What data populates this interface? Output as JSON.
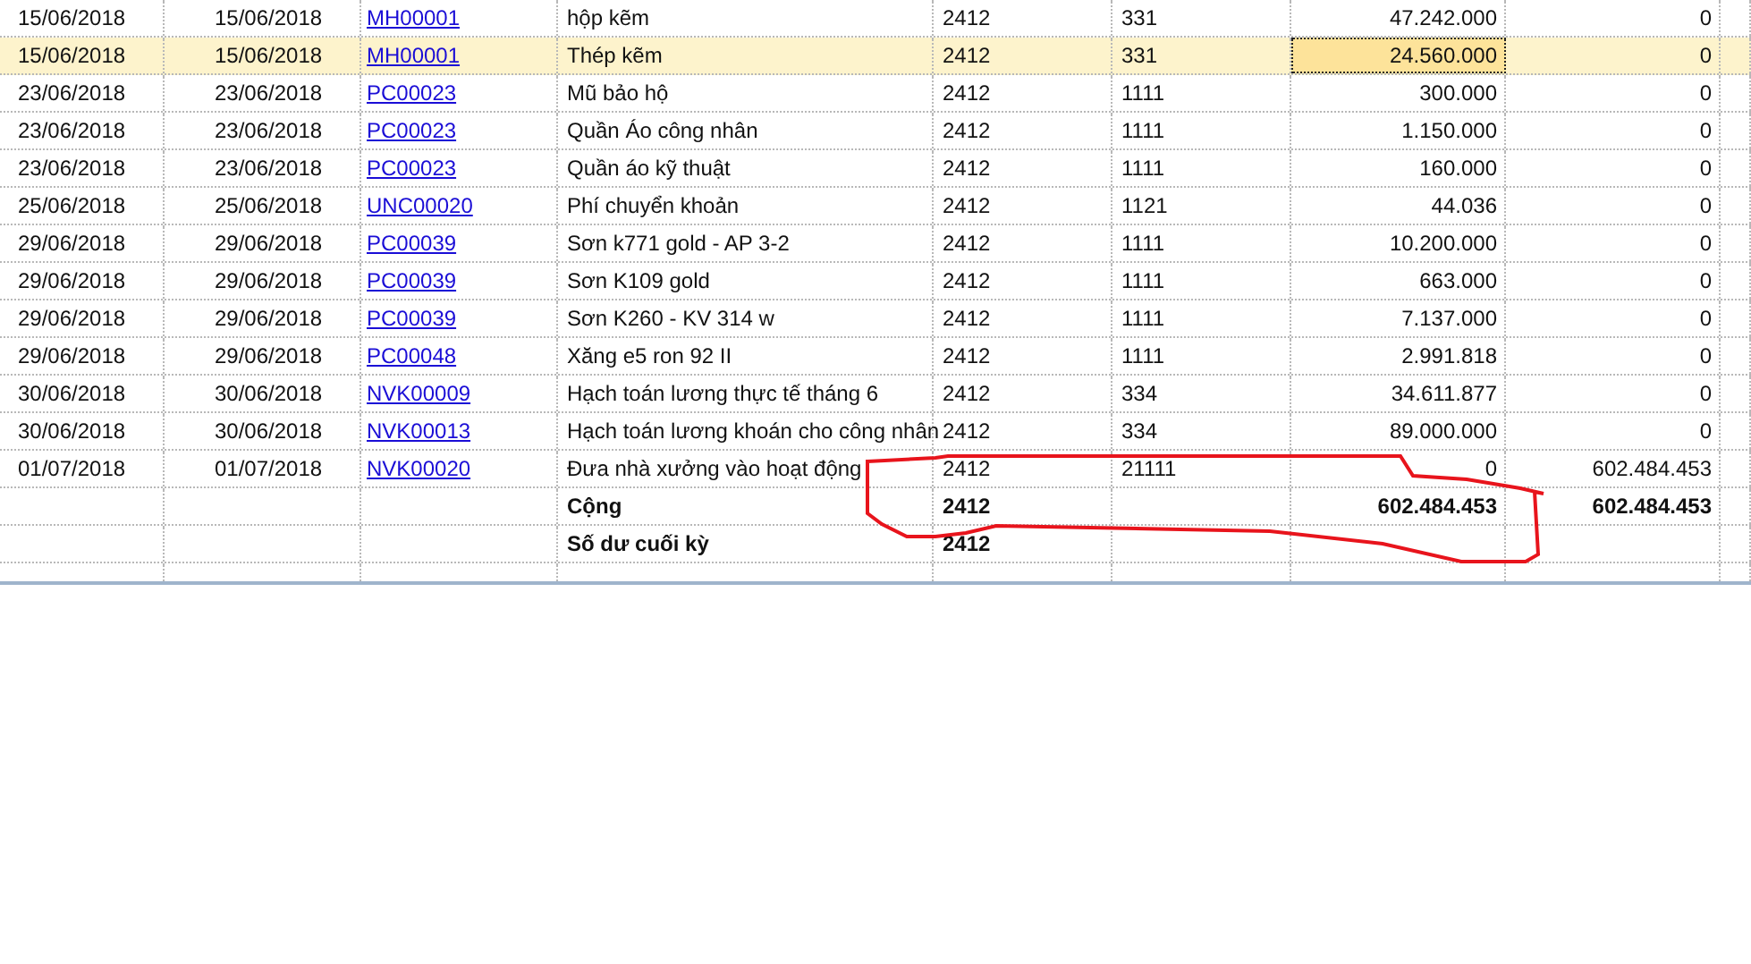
{
  "table": {
    "rows": [
      {
        "kind": "entry",
        "selected": false,
        "column_1": "15/06/2018",
        "column_2": "15/06/2018",
        "column_3": "MH00001",
        "column_4": "hộp kẽm",
        "column_5": "2412",
        "column_6": "331",
        "column_7": "47.242.000",
        "column_8": "0"
      },
      {
        "kind": "entry",
        "selected": true,
        "column_1": "15/06/2018",
        "column_2": "15/06/2018",
        "column_3": "MH00001",
        "column_4": "Thép kẽm",
        "column_5": "2412",
        "column_6": "331",
        "column_7": "24.560.000",
        "column_8": "0"
      },
      {
        "kind": "entry",
        "selected": false,
        "column_1": "23/06/2018",
        "column_2": "23/06/2018",
        "column_3": "PC00023",
        "column_4": "Mũ bảo hộ",
        "column_5": "2412",
        "column_6": "1111",
        "column_7": "300.000",
        "column_8": "0"
      },
      {
        "kind": "entry",
        "selected": false,
        "column_1": "23/06/2018",
        "column_2": "23/06/2018",
        "column_3": "PC00023",
        "column_4": "Quần Áo công nhân",
        "column_5": "2412",
        "column_6": "1111",
        "column_7": "1.150.000",
        "column_8": "0"
      },
      {
        "kind": "entry",
        "selected": false,
        "column_1": "23/06/2018",
        "column_2": "23/06/2018",
        "column_3": "PC00023",
        "column_4": "Quần áo kỹ thuật",
        "column_5": "2412",
        "column_6": "1111",
        "column_7": "160.000",
        "column_8": "0"
      },
      {
        "kind": "entry",
        "selected": false,
        "column_1": "25/06/2018",
        "column_2": "25/06/2018",
        "column_3": "UNC00020",
        "column_4": "Phí chuyển khoản",
        "column_5": "2412",
        "column_6": "1121",
        "column_7": "44.036",
        "column_8": "0"
      },
      {
        "kind": "entry",
        "selected": false,
        "column_1": "29/06/2018",
        "column_2": "29/06/2018",
        "column_3": "PC00039",
        "column_4": "Sơn k771 gold - AP 3-2",
        "column_5": "2412",
        "column_6": "1111",
        "column_7": "10.200.000",
        "column_8": "0"
      },
      {
        "kind": "entry",
        "selected": false,
        "column_1": "29/06/2018",
        "column_2": "29/06/2018",
        "column_3": "PC00039",
        "column_4": "Sơn K109 gold",
        "column_5": "2412",
        "column_6": "1111",
        "column_7": "663.000",
        "column_8": "0"
      },
      {
        "kind": "entry",
        "selected": false,
        "column_1": "29/06/2018",
        "column_2": "29/06/2018",
        "column_3": "PC00039",
        "column_4": "Sơn K260 - KV 314 w",
        "column_5": "2412",
        "column_6": "1111",
        "column_7": "7.137.000",
        "column_8": "0"
      },
      {
        "kind": "entry",
        "selected": false,
        "column_1": "29/06/2018",
        "column_2": "29/06/2018",
        "column_3": "PC00048",
        "column_4": "Xăng e5 ron 92 II",
        "column_5": "2412",
        "column_6": "1111",
        "column_7": "2.991.818",
        "column_8": "0"
      },
      {
        "kind": "entry",
        "selected": false,
        "column_1": "30/06/2018",
        "column_2": "30/06/2018",
        "column_3": "NVK00009",
        "column_4": "Hạch toán lương thực tế tháng 6",
        "column_5": "2412",
        "column_6": "334",
        "column_7": "34.611.877",
        "column_8": "0"
      },
      {
        "kind": "entry",
        "selected": false,
        "column_1": "30/06/2018",
        "column_2": "30/06/2018",
        "column_3": "NVK00013",
        "column_4": "Hạch toán lương khoán cho công nhân",
        "column_5": "2412",
        "column_6": "334",
        "column_7": "89.000.000",
        "column_8": "0"
      },
      {
        "kind": "entry",
        "selected": false,
        "column_1": "01/07/2018",
        "column_2": "01/07/2018",
        "column_3": "NVK00020",
        "column_4": "Đưa nhà xưởng vào hoạt động",
        "column_5": "2412",
        "column_6": "21111",
        "column_7": "0",
        "column_8": "602.484.453"
      },
      {
        "kind": "total",
        "selected": false,
        "column_4": "Cộng",
        "column_5": "2412",
        "column_7": "602.484.453",
        "column_8": "602.484.453"
      },
      {
        "kind": "total",
        "selected": false,
        "column_4": "Số dư cuối kỳ",
        "column_5": "2412"
      }
    ]
  }
}
